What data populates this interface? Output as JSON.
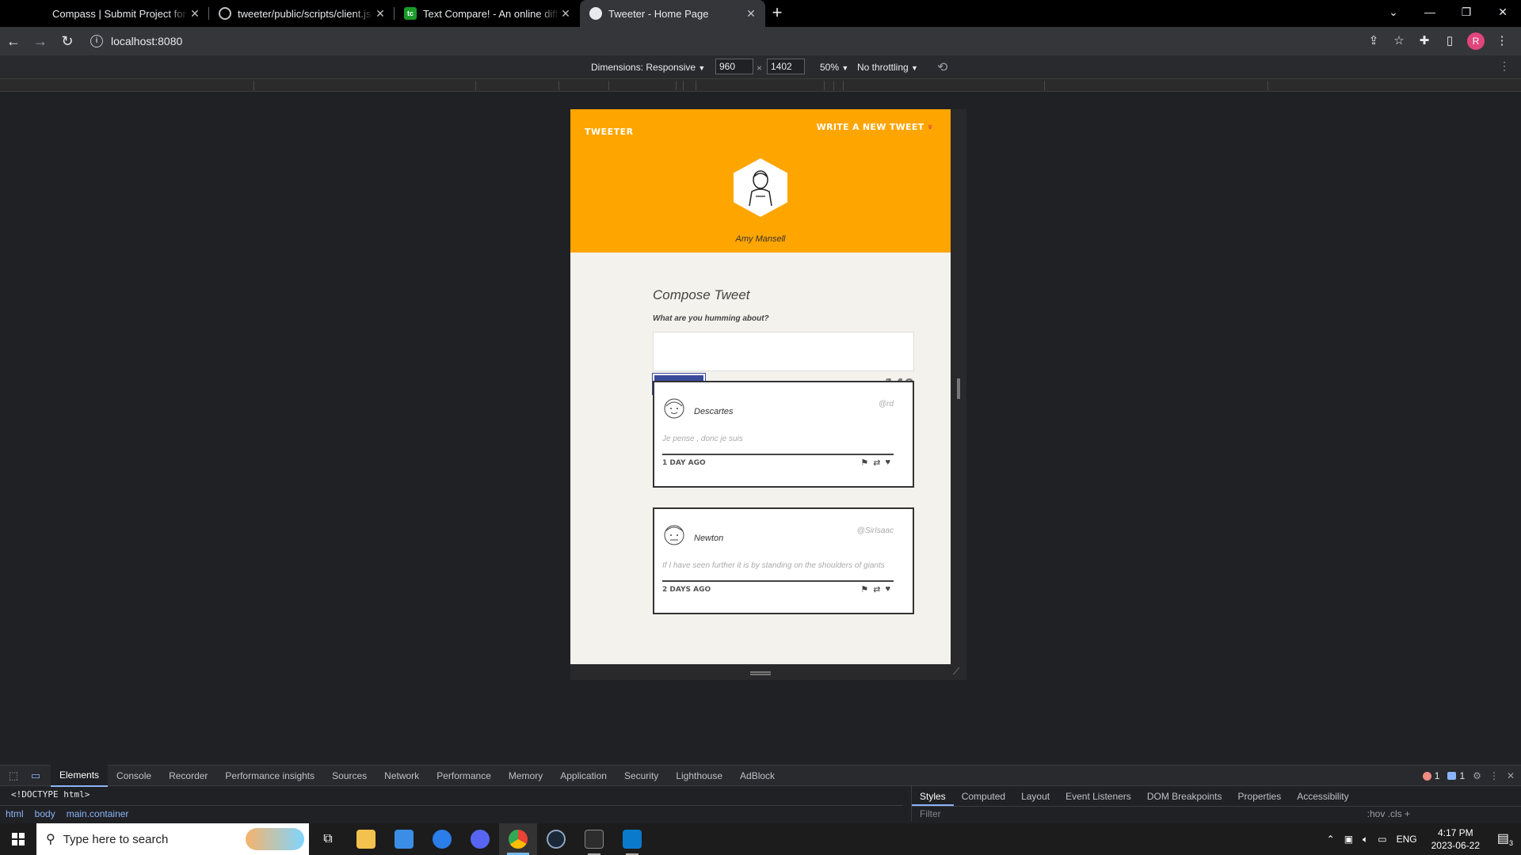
{
  "browser": {
    "tabs": [
      {
        "title": "Compass | Submit Project for Eva",
        "favicon": "blank",
        "active": false
      },
      {
        "title": "tweeter/public/scripts/client.js at",
        "favicon": "github",
        "active": false
      },
      {
        "title": "Text Compare! - An online diff to",
        "favicon": "text-compare",
        "active": false
      },
      {
        "title": "Tweeter - Home Page",
        "favicon": "globe",
        "active": true
      }
    ],
    "new_tab": "+",
    "url": "localhost:8080",
    "profile_initial": "R"
  },
  "device_toolbar": {
    "dimensions_label": "Dimensions: Responsive",
    "width": "960",
    "height": "1402",
    "times": "×",
    "zoom": "50%",
    "throttling": "No throttling"
  },
  "tweeter": {
    "brand": "TWEETER",
    "write_link": "WRITE A NEW TWEET",
    "write_arrow": "»",
    "profile_name": "Amy Mansell",
    "compose": {
      "heading": "Compose Tweet",
      "label": "What are you humming about?",
      "textarea_value": "",
      "button": "TWEET",
      "counter": "140"
    },
    "tweets": [
      {
        "name": "Descartes",
        "handle": "@rd",
        "content": "Je pense , donc je suis",
        "age": "1 DAY AGO"
      },
      {
        "name": "Newton",
        "handle": "@SirIsaac",
        "content": "If I have seen further it is by standing on the shoulders of giants",
        "age": "2 DAYS AGO"
      }
    ],
    "colors": {
      "header": "#ffa500",
      "button": "#3a4a9a",
      "background": "#f4f2ec"
    }
  },
  "devtools": {
    "tabs": [
      "Elements",
      "Console",
      "Recorder",
      "Performance insights",
      "Sources",
      "Network",
      "Performance",
      "Memory",
      "Application",
      "Security",
      "Lighthouse",
      "AdBlock"
    ],
    "active_tab": "Elements",
    "error_count": "1",
    "message_count": "1",
    "doctype": "<!DOCTYPE html>",
    "breadcrumbs": [
      "html",
      "body",
      "main.container"
    ],
    "styles_tabs": [
      "Styles",
      "Computed",
      "Layout",
      "Event Listeners",
      "DOM Breakpoints",
      "Properties",
      "Accessibility"
    ],
    "filter_placeholder": "Filter",
    "filter_tools": ":hov  .cls  +"
  },
  "taskbar": {
    "search_placeholder": "Type here to search",
    "language": "ENG",
    "time": "4:17 PM",
    "date": "2023-06-22",
    "notification_count": "3"
  }
}
